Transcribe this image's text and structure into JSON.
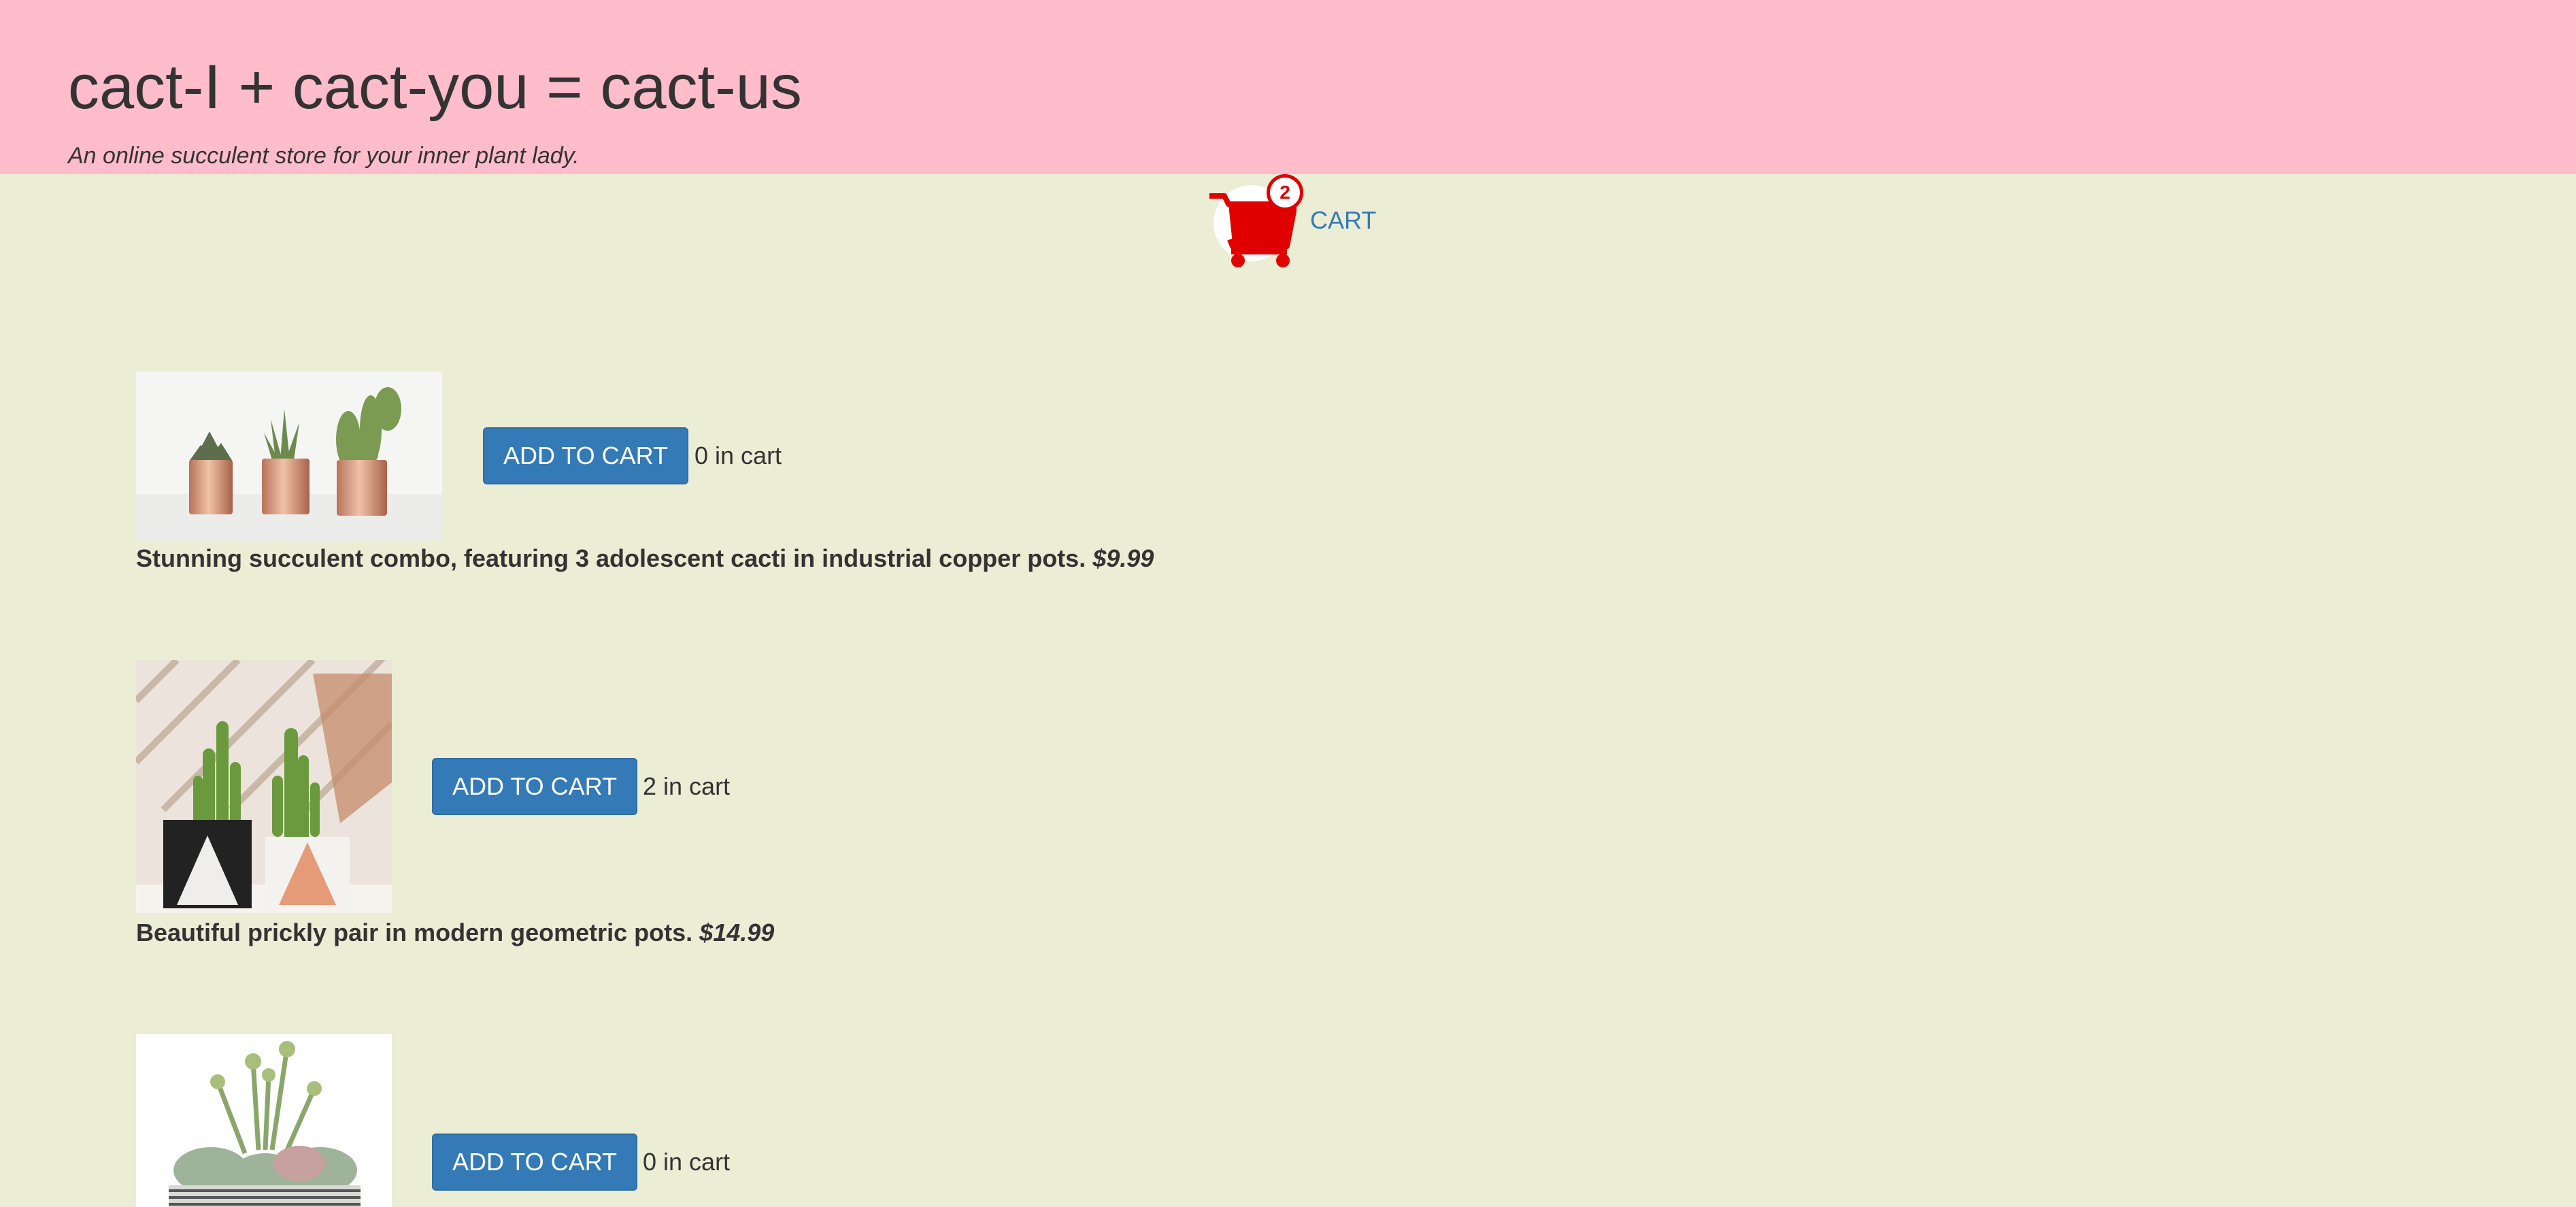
{
  "header": {
    "title": "cact-I + cact-you = cact-us",
    "tagline": "An online succulent store for your inner plant lady."
  },
  "cart": {
    "label": "CART",
    "count": "2",
    "icon": "shopping-cart-icon",
    "icon_color": "#e00000"
  },
  "products": [
    {
      "description": "Stunning succulent combo, featuring 3 adolescent cacti in industrial copper pots.",
      "price": "$9.99",
      "button_label": "ADD TO CART",
      "in_cart": "0 in cart",
      "image": "three-cacti-copper-pots"
    },
    {
      "description": "Beautiful prickly pair in modern geometric pots.",
      "price": "$14.99",
      "button_label": "ADD TO CART",
      "in_cart": "2 in cart",
      "image": "two-cacti-geometric-pots"
    },
    {
      "description": "",
      "price": "",
      "button_label": "ADD TO CART",
      "in_cart": "0 in cart",
      "image": "succulent-bowl-arrangement"
    }
  ],
  "colors": {
    "header_bg": "#ffbccb",
    "page_bg": "#ebedd5",
    "button_bg": "#337ab7",
    "link": "#337ab7",
    "text": "#333333"
  }
}
